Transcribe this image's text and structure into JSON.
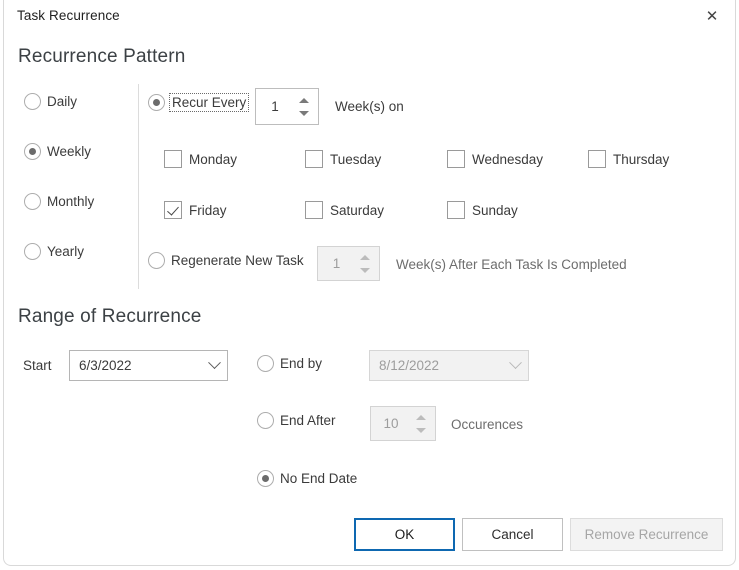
{
  "window": {
    "title": "Task Recurrence",
    "close_label": "✕"
  },
  "pattern": {
    "heading": "Recurrence Pattern",
    "frequency_options": [
      {
        "label": "Daily",
        "selected": false
      },
      {
        "label": "Weekly",
        "selected": true
      },
      {
        "label": "Monthly",
        "selected": false
      },
      {
        "label": "Yearly",
        "selected": false
      }
    ],
    "recur_every": {
      "label": "Recur Every",
      "selected": true,
      "interval_value": "1",
      "unit_label": "Week(s) on"
    },
    "weekdays": [
      {
        "label": "Monday",
        "checked": false
      },
      {
        "label": "Tuesday",
        "checked": false
      },
      {
        "label": "Wednesday",
        "checked": false
      },
      {
        "label": "Thursday",
        "checked": false
      },
      {
        "label": "Friday",
        "checked": true
      },
      {
        "label": "Saturday",
        "checked": false
      },
      {
        "label": "Sunday",
        "checked": false
      }
    ],
    "regenerate": {
      "label": "Regenerate New Task",
      "selected": false,
      "interval_value": "1",
      "suffix_label": "Week(s) After Each Task Is Completed",
      "disabled": true
    }
  },
  "range": {
    "heading": "Range of Recurrence",
    "start": {
      "label": "Start",
      "value": "6/3/2022"
    },
    "end_by": {
      "label": "End by",
      "selected": false,
      "value": "8/12/2022",
      "disabled": true
    },
    "end_after": {
      "label": "End After",
      "selected": false,
      "value": "10",
      "suffix_label": "Occurences",
      "disabled": true
    },
    "no_end_date": {
      "label": "No End Date",
      "selected": true
    }
  },
  "footer": {
    "ok_label": "OK",
    "cancel_label": "Cancel",
    "remove_label": "Remove Recurrence"
  },
  "colors": {
    "accent": "#0e68b1",
    "text": "#3b3b3b",
    "heading": "#3c4145",
    "disabled_text": "#9d9d9d"
  }
}
